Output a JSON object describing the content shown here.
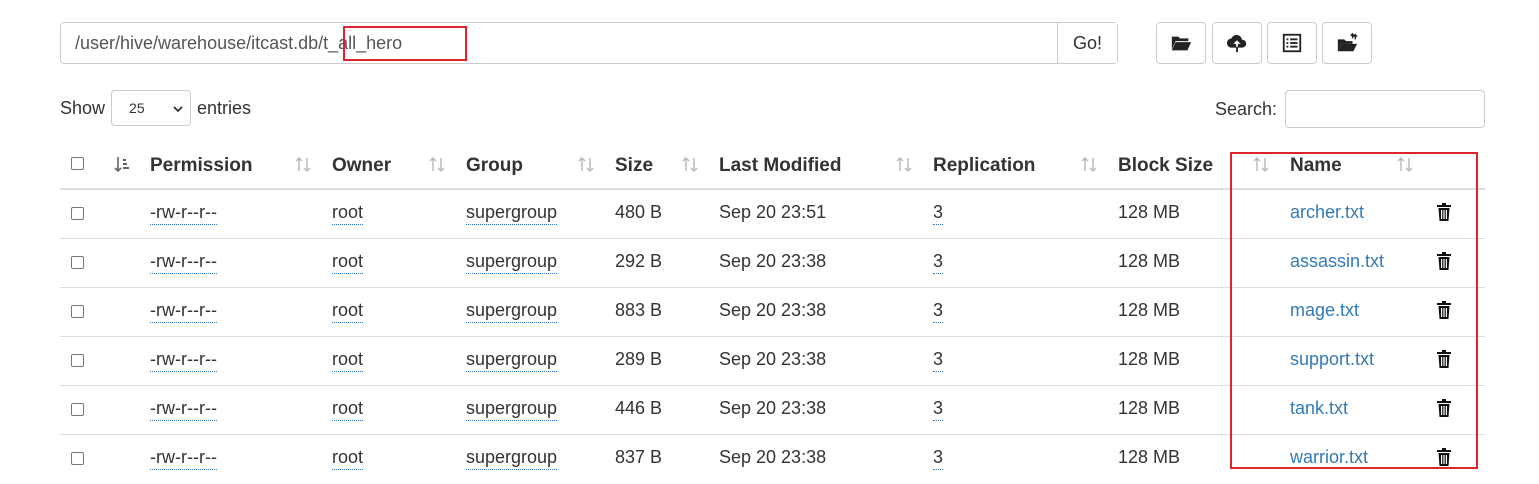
{
  "path_bar": {
    "value": "/user/hive/warehouse/itcast.db/t_all_hero",
    "go_label": "Go!"
  },
  "toolbar": {
    "icons": [
      "folder-open-icon",
      "upload-icon",
      "list-icon",
      "folder-move-icon"
    ]
  },
  "length": {
    "show_label": "Show",
    "selected": "25",
    "entries_label": "entries"
  },
  "search": {
    "label": "Search:",
    "value": ""
  },
  "columns": [
    "Permission",
    "Owner",
    "Group",
    "Size",
    "Last Modified",
    "Replication",
    "Block Size",
    "Name"
  ],
  "rows": [
    {
      "permission": "-rw-r--r--",
      "owner": "root",
      "group": "supergroup",
      "size": "480 B",
      "modified": "Sep 20 23:51",
      "replication": "3",
      "block_size": "128 MB",
      "name": "archer.txt"
    },
    {
      "permission": "-rw-r--r--",
      "owner": "root",
      "group": "supergroup",
      "size": "292 B",
      "modified": "Sep 20 23:38",
      "replication": "3",
      "block_size": "128 MB",
      "name": "assassin.txt"
    },
    {
      "permission": "-rw-r--r--",
      "owner": "root",
      "group": "supergroup",
      "size": "883 B",
      "modified": "Sep 20 23:38",
      "replication": "3",
      "block_size": "128 MB",
      "name": "mage.txt"
    },
    {
      "permission": "-rw-r--r--",
      "owner": "root",
      "group": "supergroup",
      "size": "289 B",
      "modified": "Sep 20 23:38",
      "replication": "3",
      "block_size": "128 MB",
      "name": "support.txt"
    },
    {
      "permission": "-rw-r--r--",
      "owner": "root",
      "group": "supergroup",
      "size": "446 B",
      "modified": "Sep 20 23:38",
      "replication": "3",
      "block_size": "128 MB",
      "name": "tank.txt"
    },
    {
      "permission": "-rw-r--r--",
      "owner": "root",
      "group": "supergroup",
      "size": "837 B",
      "modified": "Sep 20 23:38",
      "replication": "3",
      "block_size": "128 MB",
      "name": "warrior.txt"
    }
  ],
  "colors": {
    "link": "#337ab7",
    "highlight": "#d9262e",
    "border": "#dddddd"
  }
}
